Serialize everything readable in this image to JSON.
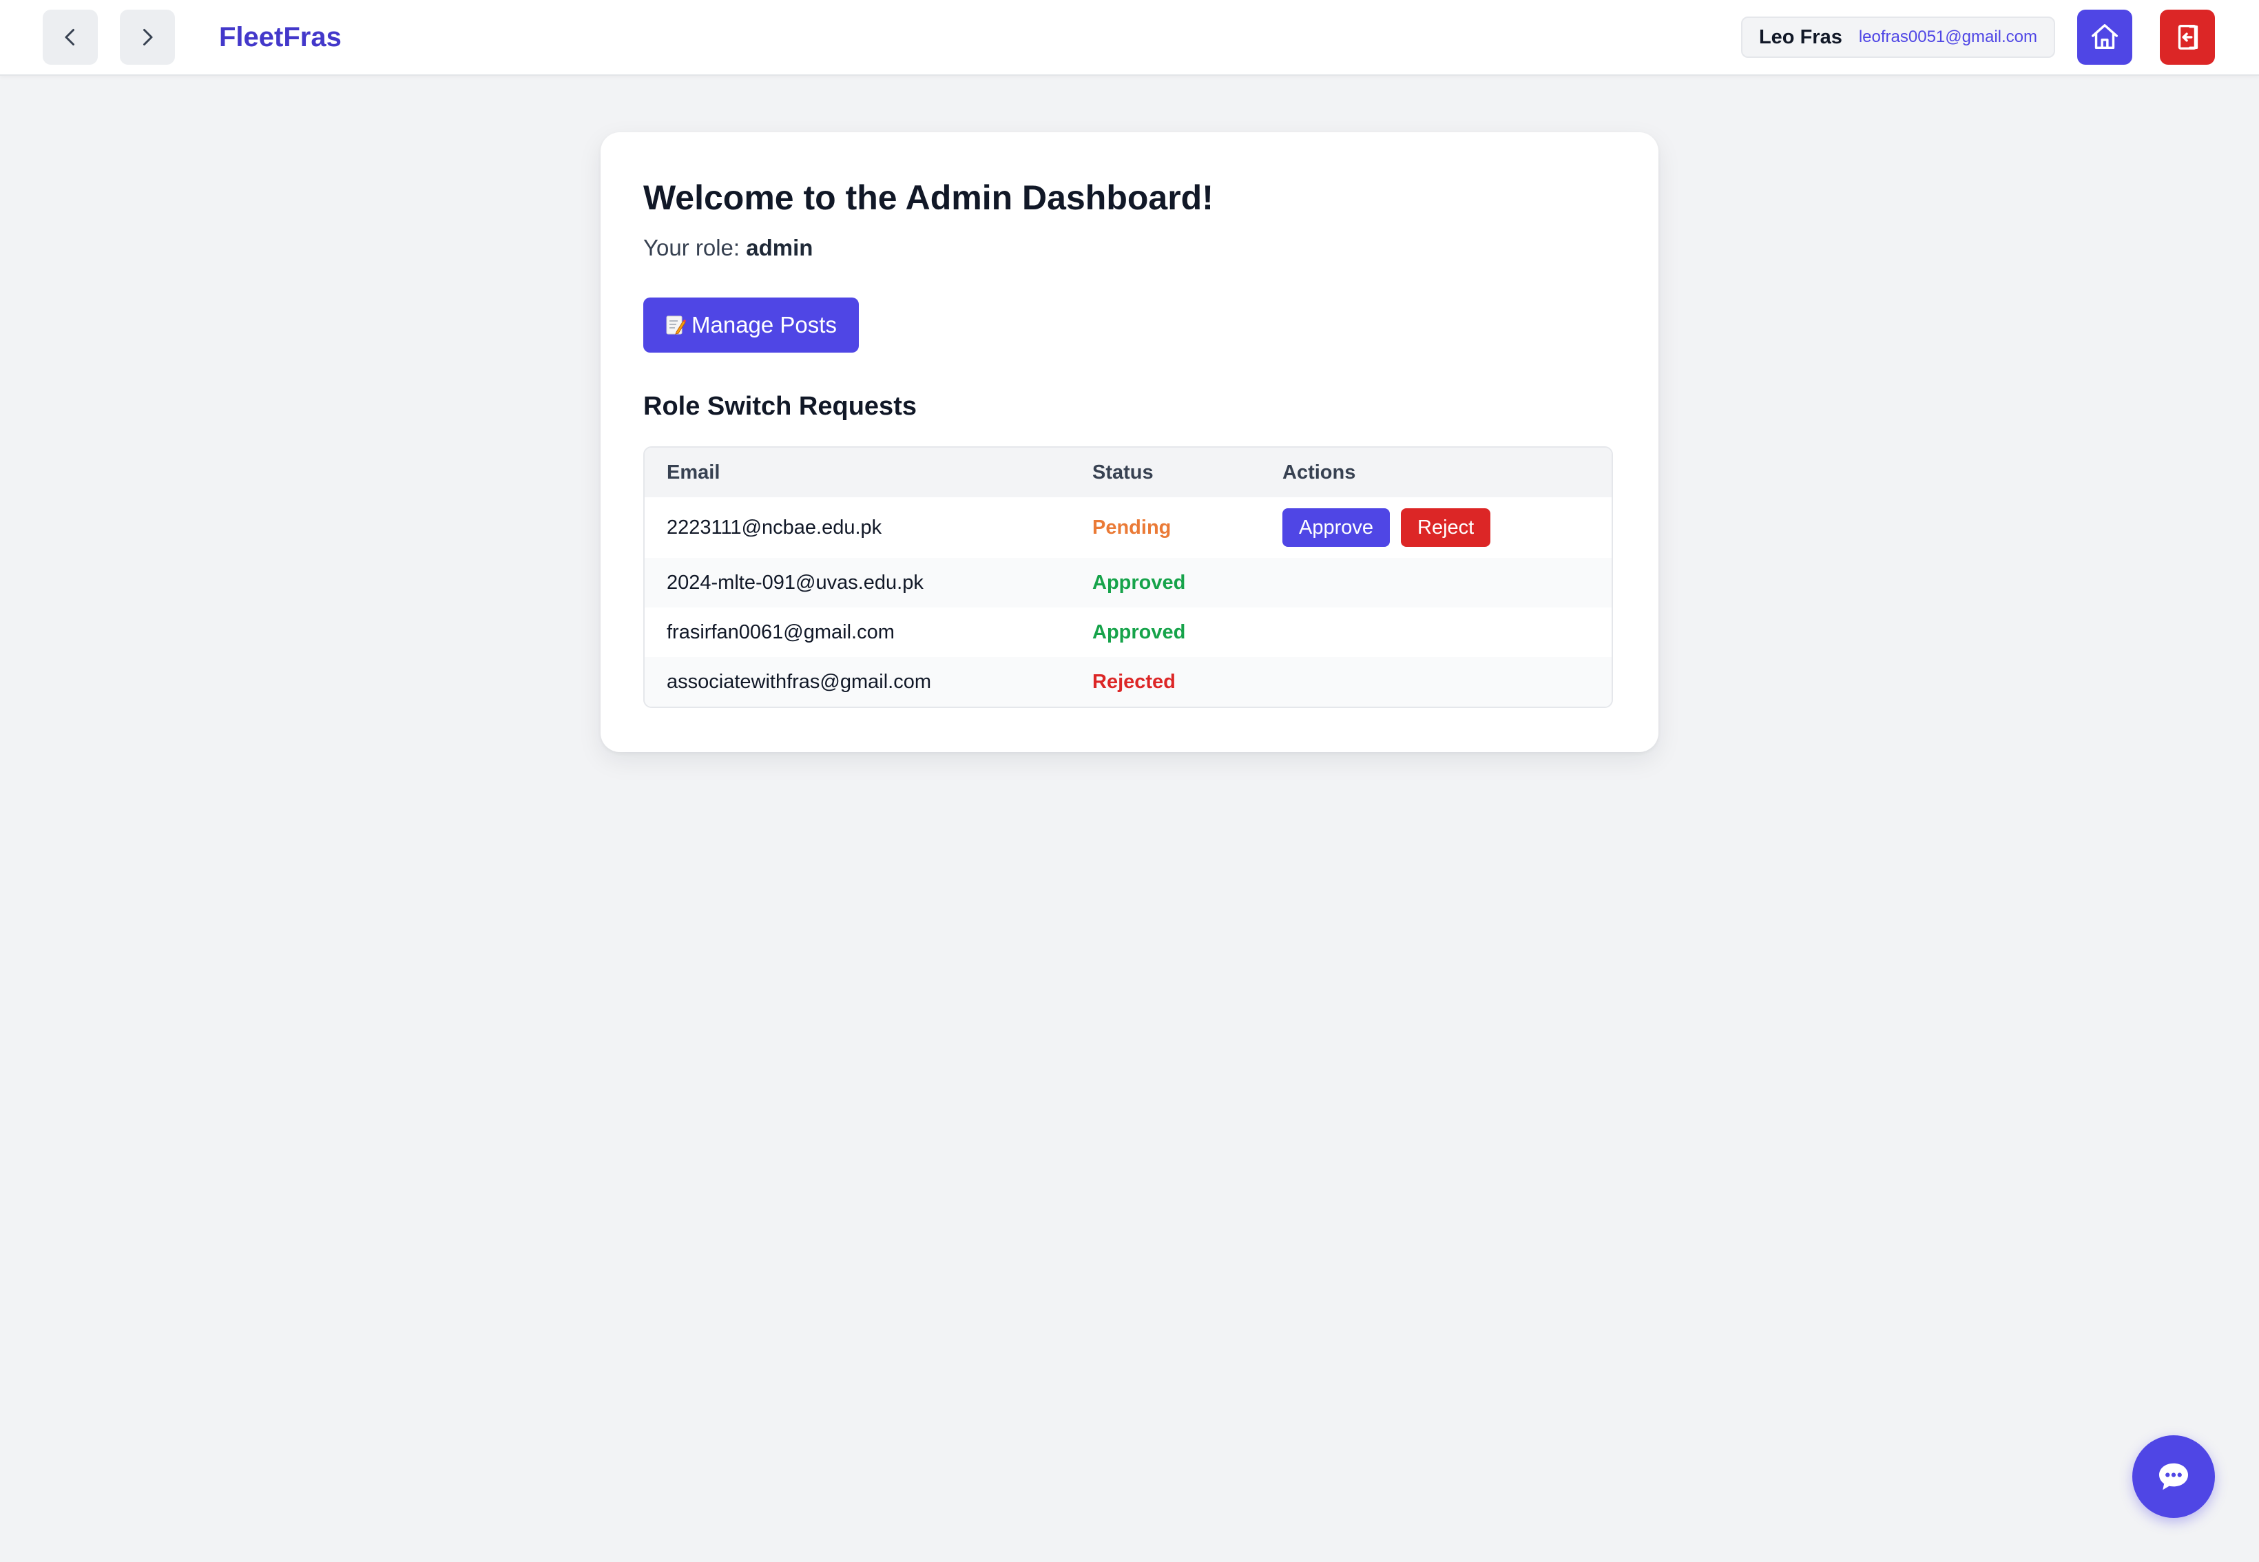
{
  "brand": "FleetFras",
  "user": {
    "name": "Leo Fras",
    "email": "leofras0051@gmail.com"
  },
  "dashboard": {
    "welcome": "Welcome to the Admin Dashboard!",
    "role_label": "Your role:",
    "role_value": "admin",
    "manage_posts_label": "Manage Posts",
    "manage_posts_icon": "memo-icon",
    "section_title": "Role Switch Requests"
  },
  "table": {
    "headers": [
      "Email",
      "Status",
      "Actions"
    ],
    "rows": [
      {
        "email": "2223111@ncbae.edu.pk",
        "status": "Pending",
        "status_color": "#ea7a36"
      },
      {
        "email": "2024-mlte-091@uvas.edu.pk",
        "status": "Approved",
        "status_color": "#16a34a"
      },
      {
        "email": "frasirfan0061@gmail.com",
        "status": "Approved",
        "status_color": "#16a34a"
      },
      {
        "email": "associatewithfras@gmail.com",
        "status": "Rejected",
        "status_color": "#dc2626"
      }
    ],
    "approve_label": "Approve",
    "reject_label": "Reject"
  },
  "colors": {
    "accent": "#4f46e5",
    "danger": "#dc2626",
    "brand_text": "#4338ca",
    "background": "#f2f3f5"
  },
  "icons": {
    "back": "chevron-left-icon",
    "forward": "chevron-right-icon",
    "home": "home-icon",
    "logout": "logout-icon",
    "chat": "chat-bubble-icon"
  }
}
